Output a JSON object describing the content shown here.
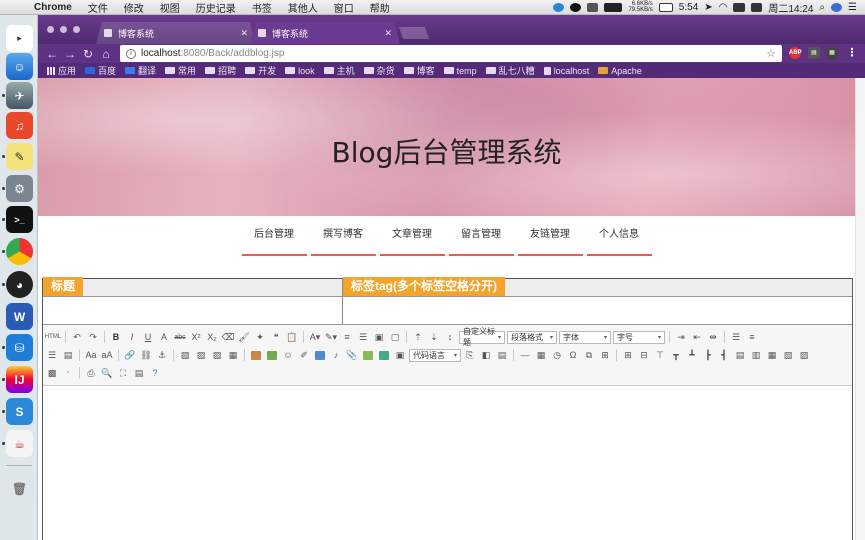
{
  "menubar": {
    "app": "Chrome",
    "items": [
      "文件",
      "修改",
      "视图",
      "历史记录",
      "书签",
      "其他人",
      "窗口",
      "帮助"
    ],
    "net_up": "6.6KB/s",
    "net_down": "79.5KB/s",
    "battery_time": "5:54",
    "clock": "周二14:24"
  },
  "browser": {
    "tabs": [
      {
        "title": "博客系统",
        "active": false
      },
      {
        "title": "博客系统",
        "active": true
      }
    ],
    "url_host": "localhost",
    "url_path": ":8080/Back/addblog.jsp",
    "bookmarks": [
      "应用",
      "百度",
      "翻译",
      "常用",
      "招聘",
      "开发",
      "look",
      "主机",
      "杂货",
      "博客",
      "temp",
      "乱七八糟",
      "localhost",
      "Apache"
    ]
  },
  "page": {
    "site_title": "Blog后台管理系统",
    "nav": [
      "后台管理",
      "撰写博客",
      "文章管理",
      "留言管理",
      "友链管理",
      "个人信息"
    ],
    "form": {
      "title_label": "标题",
      "tags_label": "标签tag(多个标签空格分开)",
      "title_value": "",
      "tags_value": ""
    },
    "editor": {
      "custom_title": "自定义标题",
      "paragraph_format": "段落格式",
      "font_family": "字体",
      "font_size": "字号",
      "code_language": "代码语言"
    }
  },
  "colors": {
    "tab_bar": "#5f3185",
    "label_bg": "#f3a42b",
    "nav_underline": "#e65a5a"
  }
}
